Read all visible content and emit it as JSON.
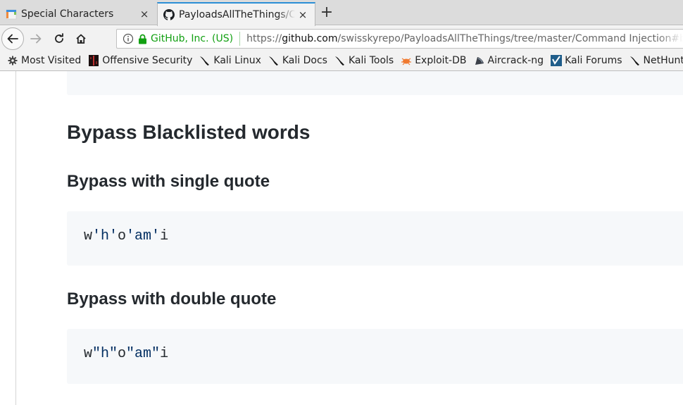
{
  "browser": {
    "tabs": [
      {
        "title": "Special Characters",
        "favicon": "calendar-page-icon",
        "active": false,
        "close_label": "×"
      },
      {
        "title": "PayloadsAllTheThings/Command Injection",
        "favicon": "github-icon",
        "active": true,
        "close_label": "×"
      }
    ],
    "new_tab_label": "+",
    "nav": {
      "back": "back-arrow-icon",
      "forward": "forward-arrow-icon",
      "reload": "reload-icon",
      "home": "home-icon"
    },
    "urlbar": {
      "identity": "GitHub, Inc. (US)",
      "url_scheme": "https://",
      "url_host": "github.com",
      "url_path": "/swisskyrepo/PayloadsAllTheThings/tree/master/Command Injection#bypass-w"
    },
    "bookmarks": [
      {
        "label": "Most Visited",
        "icon": "gear-icon"
      },
      {
        "label": "Offensive Security",
        "icon": "offsec-icon"
      },
      {
        "label": "Kali Linux",
        "icon": "kali-dragon-icon"
      },
      {
        "label": "Kali Docs",
        "icon": "kali-dragon-icon"
      },
      {
        "label": "Kali Tools",
        "icon": "kali-dragon-icon"
      },
      {
        "label": "Exploit-DB",
        "icon": "bug-icon"
      },
      {
        "label": "Aircrack-ng",
        "icon": "aircrack-icon"
      },
      {
        "label": "Kali Forums",
        "icon": "forums-icon"
      },
      {
        "label": "NetHunter",
        "icon": "kali-dragon-icon"
      },
      {
        "label": "",
        "icon": "kali-dragon-icon"
      }
    ]
  },
  "content": {
    "heading_main": "Bypass Blacklisted words",
    "sections": [
      {
        "heading": "Bypass with single quote",
        "code_tokens": [
          {
            "text": "w",
            "type": "plain"
          },
          {
            "text": "'h'",
            "type": "string"
          },
          {
            "text": "o",
            "type": "plain"
          },
          {
            "text": "'am'",
            "type": "string"
          },
          {
            "text": "i",
            "type": "plain"
          }
        ]
      },
      {
        "heading": "Bypass with double quote",
        "code_tokens": [
          {
            "text": "w",
            "type": "plain"
          },
          {
            "text": "\"h\"",
            "type": "string"
          },
          {
            "text": "o",
            "type": "plain"
          },
          {
            "text": "\"am\"",
            "type": "string"
          },
          {
            "text": "i",
            "type": "plain"
          }
        ]
      }
    ]
  },
  "colors": {
    "tab_accent": "#2c8fd6",
    "secure_identity": "#12a012",
    "code_bg": "#f6f8fa",
    "code_string": "#032f62",
    "heading_text": "#24292e"
  }
}
